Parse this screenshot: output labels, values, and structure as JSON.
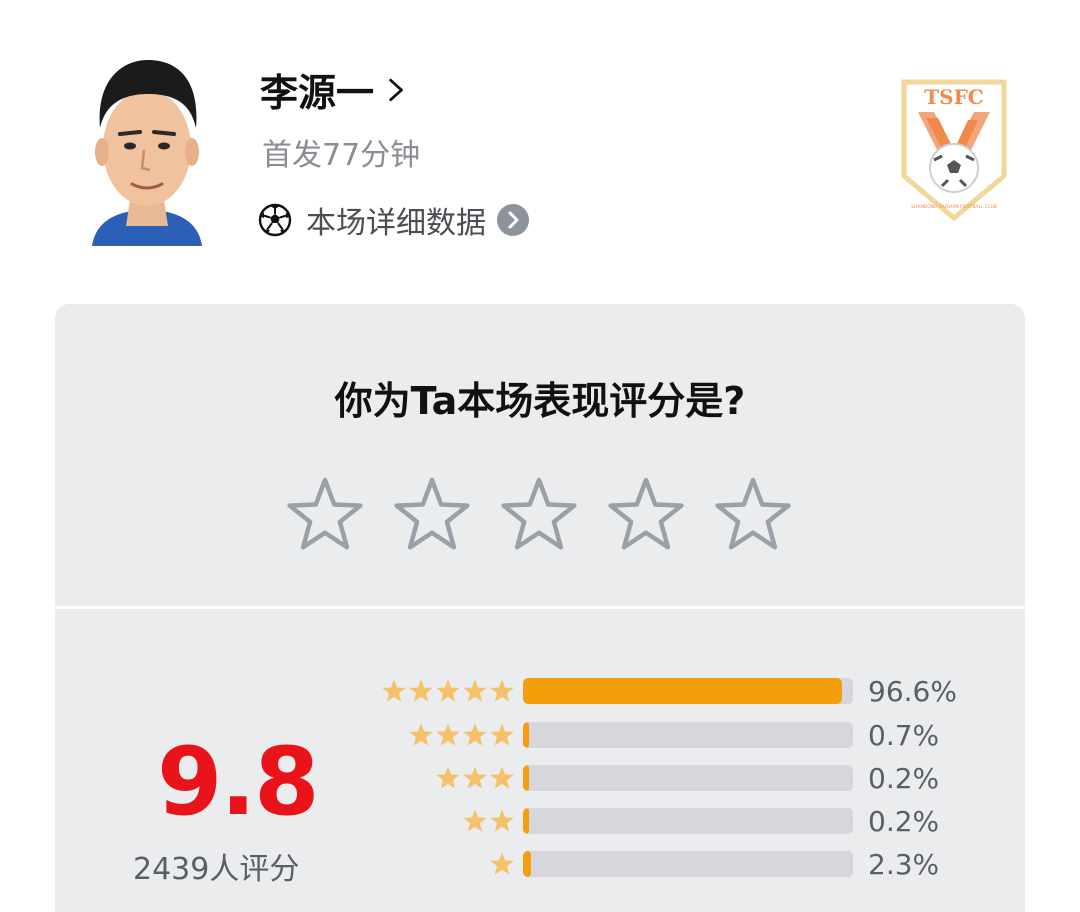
{
  "player": {
    "name": "李源一",
    "minutes": "首发77分钟",
    "details_link": "本场详细数据"
  },
  "club": {
    "logo_text": "TSFC",
    "logo_subtext": "SHANDONG TAISHAN FOOTBALL CLUB",
    "colors": {
      "primary": "#f08a4b",
      "border": "#f2d79a"
    }
  },
  "rating_prompt": {
    "question": "你为Ta本场表现评分是?",
    "star_count": 5
  },
  "rating_summary": {
    "score": "9.8",
    "count_label": "2439人评分",
    "distribution": [
      {
        "stars": 5,
        "percent_label": "96.6%",
        "fraction": 0.966
      },
      {
        "stars": 4,
        "percent_label": "0.7%",
        "fraction": 0.007
      },
      {
        "stars": 3,
        "percent_label": "0.2%",
        "fraction": 0.002
      },
      {
        "stars": 2,
        "percent_label": "0.2%",
        "fraction": 0.002
      },
      {
        "stars": 1,
        "percent_label": "2.3%",
        "fraction": 0.023
      }
    ]
  },
  "colors": {
    "score": "#e8141a",
    "bar_fill": "#f59e0b",
    "bar_track": "#d5d7dc",
    "mini_star": "#f5c26b",
    "card_bg": "#ebecee"
  }
}
